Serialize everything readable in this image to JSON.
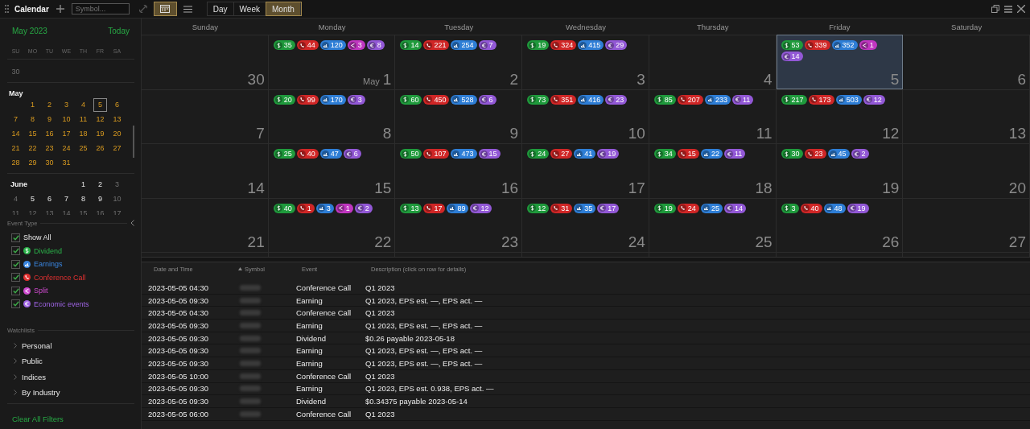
{
  "toolbar": {
    "title": "Calendar",
    "search": {
      "placeholder": "Symbol..."
    },
    "views": [
      {
        "kind": "calendar",
        "selected": true
      },
      {
        "kind": "list",
        "selected": false
      }
    ],
    "ranges": [
      {
        "label": "Day",
        "selected": false
      },
      {
        "label": "Week",
        "selected": false
      },
      {
        "label": "Month",
        "selected": true
      }
    ]
  },
  "mini_calendar": {
    "title": "May 2023",
    "today": "Today",
    "weekdays": [
      "SU",
      "MO",
      "TU",
      "WE",
      "TH",
      "FR",
      "SA"
    ],
    "months": [
      {
        "weeks": [
          [
            {
              "kind": "day",
              "day": "30",
              "selected": false,
              "dim": true
            }
          ]
        ]
      },
      {
        "name": "May",
        "weeks": [
          [
            {
              "kind": "blank"
            },
            {
              "kind": "day",
              "day": "1",
              "selected": false,
              "dim": false
            },
            {
              "kind": "day",
              "day": "2",
              "selected": false,
              "dim": false
            },
            {
              "kind": "day",
              "day": "3",
              "selected": false,
              "dim": false
            },
            {
              "kind": "day",
              "day": "4",
              "selected": false,
              "dim": false
            },
            {
              "kind": "day",
              "day": "5",
              "selected": true,
              "dim": false
            },
            {
              "kind": "day",
              "day": "6",
              "selected": false,
              "dim": false
            }
          ],
          [
            {
              "kind": "day",
              "day": "7",
              "selected": false,
              "dim": false
            },
            {
              "kind": "day",
              "day": "8",
              "selected": false,
              "dim": false
            },
            {
              "kind": "day",
              "day": "9",
              "selected": false,
              "dim": false
            },
            {
              "kind": "day",
              "day": "10",
              "selected": false,
              "dim": false
            },
            {
              "kind": "day",
              "day": "11",
              "selected": false,
              "dim": false
            },
            {
              "kind": "day",
              "day": "12",
              "selected": false,
              "dim": false
            },
            {
              "kind": "day",
              "day": "13",
              "selected": false,
              "dim": false
            }
          ],
          [
            {
              "kind": "day",
              "day": "14",
              "selected": false,
              "dim": false
            },
            {
              "kind": "day",
              "day": "15",
              "selected": false,
              "dim": false
            },
            {
              "kind": "day",
              "day": "16",
              "selected": false,
              "dim": false
            },
            {
              "kind": "day",
              "day": "17",
              "selected": false,
              "dim": false
            },
            {
              "kind": "day",
              "day": "18",
              "selected": false,
              "dim": false
            },
            {
              "kind": "day",
              "day": "19",
              "selected": false,
              "dim": false
            },
            {
              "kind": "day",
              "day": "20",
              "selected": false,
              "dim": false
            }
          ],
          [
            {
              "kind": "day",
              "day": "21",
              "selected": false,
              "dim": false
            },
            {
              "kind": "day",
              "day": "22",
              "selected": false,
              "dim": false
            },
            {
              "kind": "day",
              "day": "23",
              "selected": false,
              "dim": false
            },
            {
              "kind": "day",
              "day": "24",
              "selected": false,
              "dim": false
            },
            {
              "kind": "day",
              "day": "25",
              "selected": false,
              "dim": false
            },
            {
              "kind": "day",
              "day": "26",
              "selected": false,
              "dim": false
            },
            {
              "kind": "day",
              "day": "27",
              "selected": false,
              "dim": false
            }
          ],
          [
            {
              "kind": "day",
              "day": "28",
              "selected": false,
              "dim": false
            },
            {
              "kind": "day",
              "day": "29",
              "selected": false,
              "dim": false
            },
            {
              "kind": "day",
              "day": "30",
              "selected": false,
              "dim": false
            },
            {
              "kind": "day",
              "day": "31",
              "selected": false,
              "dim": false
            }
          ]
        ]
      },
      {
        "name": "June",
        "weeks": [
          [
            {
              "kind": "blank"
            },
            {
              "kind": "blank"
            },
            {
              "kind": "blank"
            },
            {
              "kind": "blank"
            },
            {
              "kind": "day",
              "day": "1",
              "selected": false,
              "dim": false
            },
            {
              "kind": "day",
              "day": "2",
              "selected": false,
              "dim": false
            },
            {
              "kind": "day",
              "day": "3",
              "selected": false,
              "dim": true
            }
          ],
          [
            {
              "kind": "day",
              "day": "4",
              "selected": false,
              "dim": true
            },
            {
              "kind": "day",
              "day": "5",
              "selected": false,
              "dim": false
            },
            {
              "kind": "day",
              "day": "6",
              "selected": false,
              "dim": false
            },
            {
              "kind": "day",
              "day": "7",
              "selected": false,
              "dim": false
            },
            {
              "kind": "day",
              "day": "8",
              "selected": false,
              "dim": false
            },
            {
              "kind": "day",
              "day": "9",
              "selected": false,
              "dim": false
            },
            {
              "kind": "day",
              "day": "10",
              "selected": false,
              "dim": true
            }
          ],
          [
            {
              "kind": "day",
              "day": "11",
              "selected": false,
              "dim": true
            },
            {
              "kind": "day",
              "day": "12",
              "selected": false,
              "dim": true
            },
            {
              "kind": "day",
              "day": "13",
              "selected": false,
              "dim": true
            },
            {
              "kind": "day",
              "day": "14",
              "selected": false,
              "dim": true
            },
            {
              "kind": "day",
              "day": "15",
              "selected": false,
              "dim": true
            },
            {
              "kind": "day",
              "day": "16",
              "selected": false,
              "dim": true
            },
            {
              "kind": "day",
              "day": "17",
              "selected": false,
              "dim": true
            }
          ]
        ]
      }
    ]
  },
  "event_types": {
    "title": "Event Type",
    "items": [
      {
        "kind": "all",
        "label": "Show All",
        "checked": true
      },
      {
        "kind": "dividend",
        "label": "Dividend",
        "checked": true,
        "color": "#2bb44a"
      },
      {
        "kind": "earnings",
        "label": "Earnings",
        "checked": true,
        "color": "#3a86e0"
      },
      {
        "kind": "conference_call",
        "label": "Conference Call",
        "checked": true,
        "color": "#e03030"
      },
      {
        "kind": "split",
        "label": "Split",
        "checked": true,
        "color": "#d04ad0"
      },
      {
        "kind": "economic",
        "label": "Economic events",
        "checked": true,
        "color": "#a064e6"
      }
    ]
  },
  "watchlists": {
    "title": "Watchlists",
    "items": [
      {
        "label": "Personal",
        "expanded": false
      },
      {
        "label": "Public",
        "expanded": false
      },
      {
        "label": "Indices",
        "expanded": false
      },
      {
        "label": "By Industry",
        "expanded": false
      }
    ]
  },
  "clear_filters": "Clear All Filters",
  "calendar": {
    "weekdays": [
      "Sunday",
      "Monday",
      "Tuesday",
      "Wednesday",
      "Thursday",
      "Friday",
      "Saturday"
    ],
    "weeks": [
      {
        "days": [
          {
            "date": "30",
            "selected": false
          },
          {
            "month": "May",
            "date": "1",
            "selected": false,
            "events": [
              {
                "kind": "dividend",
                "count": "35"
              },
              {
                "kind": "conference_call",
                "count": "44"
              },
              {
                "kind": "earnings",
                "count": "120"
              },
              {
                "kind": "split",
                "count": "3"
              },
              {
                "kind": "economic",
                "count": "8"
              }
            ]
          },
          {
            "date": "2",
            "selected": false,
            "events": [
              {
                "kind": "dividend",
                "count": "14"
              },
              {
                "kind": "conference_call",
                "count": "221"
              },
              {
                "kind": "earnings",
                "count": "254"
              },
              {
                "kind": "economic",
                "count": "7"
              }
            ]
          },
          {
            "date": "3",
            "selected": false,
            "events": [
              {
                "kind": "dividend",
                "count": "19"
              },
              {
                "kind": "conference_call",
                "count": "324"
              },
              {
                "kind": "earnings",
                "count": "415"
              },
              {
                "kind": "economic",
                "count": "29"
              }
            ]
          },
          {
            "date": "4",
            "selected": false
          },
          {
            "date": "5",
            "selected": true,
            "events": [
              {
                "kind": "dividend",
                "count": "53"
              },
              {
                "kind": "conference_call",
                "count": "339"
              },
              {
                "kind": "earnings",
                "count": "352"
              },
              {
                "kind": "split",
                "count": "1"
              },
              {
                "kind": "economic",
                "count": "14"
              }
            ]
          },
          {
            "date": "6",
            "selected": false
          }
        ]
      },
      {
        "days": [
          {
            "date": "7",
            "selected": false
          },
          {
            "date": "8",
            "selected": false,
            "events": [
              {
                "kind": "dividend",
                "count": "20"
              },
              {
                "kind": "conference_call",
                "count": "99"
              },
              {
                "kind": "earnings",
                "count": "170"
              },
              {
                "kind": "economic",
                "count": "3"
              }
            ]
          },
          {
            "date": "9",
            "selected": false,
            "events": [
              {
                "kind": "dividend",
                "count": "60"
              },
              {
                "kind": "conference_call",
                "count": "450"
              },
              {
                "kind": "earnings",
                "count": "528"
              },
              {
                "kind": "economic",
                "count": "6"
              }
            ]
          },
          {
            "date": "10",
            "selected": false,
            "events": [
              {
                "kind": "dividend",
                "count": "73"
              },
              {
                "kind": "conference_call",
                "count": "351"
              },
              {
                "kind": "earnings",
                "count": "416"
              },
              {
                "kind": "economic",
                "count": "23"
              }
            ]
          },
          {
            "date": "11",
            "selected": false,
            "events": [
              {
                "kind": "dividend",
                "count": "85"
              },
              {
                "kind": "conference_call",
                "count": "207"
              },
              {
                "kind": "earnings",
                "count": "233"
              },
              {
                "kind": "economic",
                "count": "11"
              }
            ]
          },
          {
            "date": "12",
            "selected": false,
            "events": [
              {
                "kind": "dividend",
                "count": "217"
              },
              {
                "kind": "conference_call",
                "count": "173"
              },
              {
                "kind": "earnings",
                "count": "503"
              },
              {
                "kind": "economic",
                "count": "12"
              }
            ]
          },
          {
            "date": "13",
            "selected": false
          }
        ]
      },
      {
        "days": [
          {
            "date": "14",
            "selected": false
          },
          {
            "date": "15",
            "selected": false,
            "events": [
              {
                "kind": "dividend",
                "count": "25"
              },
              {
                "kind": "conference_call",
                "count": "40"
              },
              {
                "kind": "earnings",
                "count": "47"
              },
              {
                "kind": "economic",
                "count": "6"
              }
            ]
          },
          {
            "date": "16",
            "selected": false,
            "events": [
              {
                "kind": "dividend",
                "count": "50"
              },
              {
                "kind": "conference_call",
                "count": "107"
              },
              {
                "kind": "earnings",
                "count": "473"
              },
              {
                "kind": "economic",
                "count": "15"
              }
            ]
          },
          {
            "date": "17",
            "selected": false,
            "events": [
              {
                "kind": "dividend",
                "count": "24"
              },
              {
                "kind": "conference_call",
                "count": "27"
              },
              {
                "kind": "earnings",
                "count": "41"
              },
              {
                "kind": "economic",
                "count": "19"
              }
            ]
          },
          {
            "date": "18",
            "selected": false,
            "events": [
              {
                "kind": "dividend",
                "count": "34"
              },
              {
                "kind": "conference_call",
                "count": "15"
              },
              {
                "kind": "earnings",
                "count": "22"
              },
              {
                "kind": "economic",
                "count": "11"
              }
            ]
          },
          {
            "date": "19",
            "selected": false,
            "events": [
              {
                "kind": "dividend",
                "count": "30"
              },
              {
                "kind": "conference_call",
                "count": "23"
              },
              {
                "kind": "earnings",
                "count": "45"
              },
              {
                "kind": "economic",
                "count": "2"
              }
            ]
          },
          {
            "date": "20",
            "selected": false
          }
        ]
      },
      {
        "days": [
          {
            "date": "21",
            "selected": false
          },
          {
            "date": "22",
            "selected": false,
            "events": [
              {
                "kind": "dividend",
                "count": "40"
              },
              {
                "kind": "conference_call",
                "count": "1"
              },
              {
                "kind": "earnings",
                "count": "3"
              },
              {
                "kind": "split",
                "count": "1"
              },
              {
                "kind": "economic",
                "count": "2"
              }
            ]
          },
          {
            "date": "23",
            "selected": false,
            "events": [
              {
                "kind": "dividend",
                "count": "13"
              },
              {
                "kind": "conference_call",
                "count": "17"
              },
              {
                "kind": "earnings",
                "count": "89"
              },
              {
                "kind": "economic",
                "count": "12"
              }
            ]
          },
          {
            "date": "24",
            "selected": false,
            "events": [
              {
                "kind": "dividend",
                "count": "12"
              },
              {
                "kind": "conference_call",
                "count": "31"
              },
              {
                "kind": "earnings",
                "count": "35"
              },
              {
                "kind": "economic",
                "count": "17"
              }
            ]
          },
          {
            "date": "25",
            "selected": false,
            "events": [
              {
                "kind": "dividend",
                "count": "19"
              },
              {
                "kind": "conference_call",
                "count": "24"
              },
              {
                "kind": "earnings",
                "count": "25"
              },
              {
                "kind": "economic",
                "count": "14"
              }
            ]
          },
          {
            "date": "26",
            "selected": false,
            "events": [
              {
                "kind": "dividend",
                "count": "3"
              },
              {
                "kind": "conference_call",
                "count": "40"
              },
              {
                "kind": "earnings",
                "count": "48"
              },
              {
                "kind": "economic",
                "count": "19"
              }
            ]
          },
          {
            "date": "27",
            "selected": false
          }
        ]
      }
    ]
  },
  "table": {
    "columns": [
      {
        "label": "Date and Time",
        "sorted": false
      },
      {
        "label": "Symbol",
        "sorted": true
      },
      {
        "label": "Event",
        "sorted": false
      },
      {
        "label": "Description (click on row for details)",
        "sorted": false
      }
    ],
    "rows": [
      {
        "time": "2023-05-05 04:30",
        "event": "Conference Call",
        "description": "Q1 2023"
      },
      {
        "time": "2023-05-05 09:30",
        "event": "Earning",
        "description": "Q1 2023, EPS est. —, EPS act. —"
      },
      {
        "time": "2023-05-05 04:30",
        "event": "Conference Call",
        "description": "Q1 2023"
      },
      {
        "time": "2023-05-05 09:30",
        "event": "Earning",
        "description": "Q1 2023, EPS est. —, EPS act. —"
      },
      {
        "time": "2023-05-05 09:30",
        "event": "Dividend",
        "description": "$0.26 payable 2023-05-18"
      },
      {
        "time": "2023-05-05 09:30",
        "event": "Earning",
        "description": "Q1 2023, EPS est. —, EPS act. —"
      },
      {
        "time": "2023-05-05 09:30",
        "event": "Earning",
        "description": "Q1 2023, EPS est. —, EPS act. —"
      },
      {
        "time": "2023-05-05 10:00",
        "event": "Conference Call",
        "description": "Q1 2023"
      },
      {
        "time": "2023-05-05 09:30",
        "event": "Earning",
        "description": "Q1 2023, EPS est. 0.938, EPS act. —"
      },
      {
        "time": "2023-05-05 09:30",
        "event": "Dividend",
        "description": "$0.34375 payable 2023-05-14"
      },
      {
        "time": "2023-05-05 06:00",
        "event": "Conference Call",
        "description": "Q1 2023"
      }
    ]
  }
}
